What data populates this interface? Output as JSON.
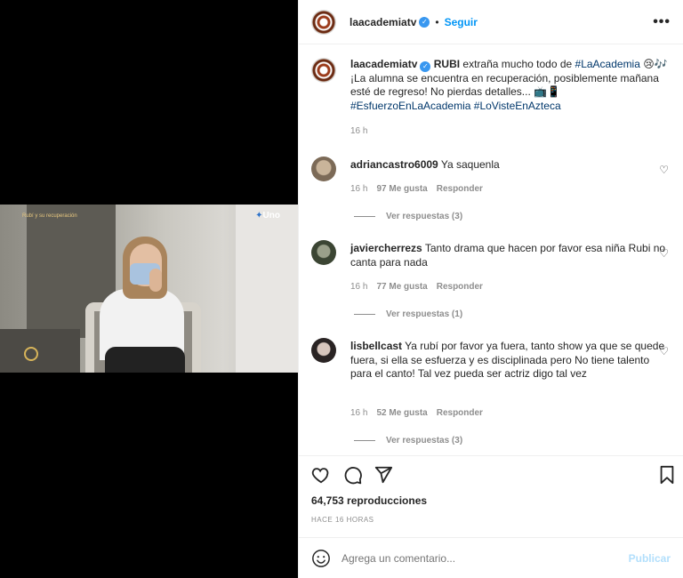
{
  "post": {
    "username": "laacademiatv",
    "follow_label": "Seguir",
    "more_label": "•••",
    "dot": "•"
  },
  "caption": {
    "username": "laacademiatv",
    "name_bold": "RUBI",
    "text_1": "extraña mucho todo de",
    "hashtag_1": "#LaAcademia",
    "text_2": "😢🎶 ¡La alumna se encuentra en recuperación, posiblemente mañana esté de regreso! No pierdas detalles... 📺📱",
    "hashtag_2": "#EsfuerzoEnLaAcademia",
    "hashtag_3": "#LoVisteEnAzteca",
    "time": "16 h"
  },
  "comments": [
    {
      "username": "adriancastro6009",
      "text": "Ya saquenla",
      "time": "16 h",
      "likes": "97 Me gusta",
      "reply": "Responder",
      "view_replies": "Ver respuestas (3)"
    },
    {
      "username": "javiercherrezs",
      "text": "Tanto drama que hacen por favor esa niña Rubi no canta para nada",
      "time": "16 h",
      "likes": "77 Me gusta",
      "reply": "Responder",
      "view_replies": "Ver respuestas (1)"
    },
    {
      "username": "lisbellcast",
      "text": "Ya rubí por favor ya fuera, tanto show ya que se quede fuera, si ella se esfuerza y es disciplinada pero No tiene talento para el canto! Tal vez pueda ser actriz digo tal vez",
      "time": "16 h",
      "likes": "52 Me gusta",
      "reply": "Responder",
      "view_replies": "Ver respuestas (3)"
    }
  ],
  "stats": {
    "views": "64,753 reproducciones",
    "posted": "HACE 16 HORAS"
  },
  "composer": {
    "placeholder": "Agrega un comentario...",
    "publish_label": "Publicar"
  },
  "video": {
    "overlay_caption": "Rubí y su recuperación",
    "channel_logo": "Uno"
  }
}
